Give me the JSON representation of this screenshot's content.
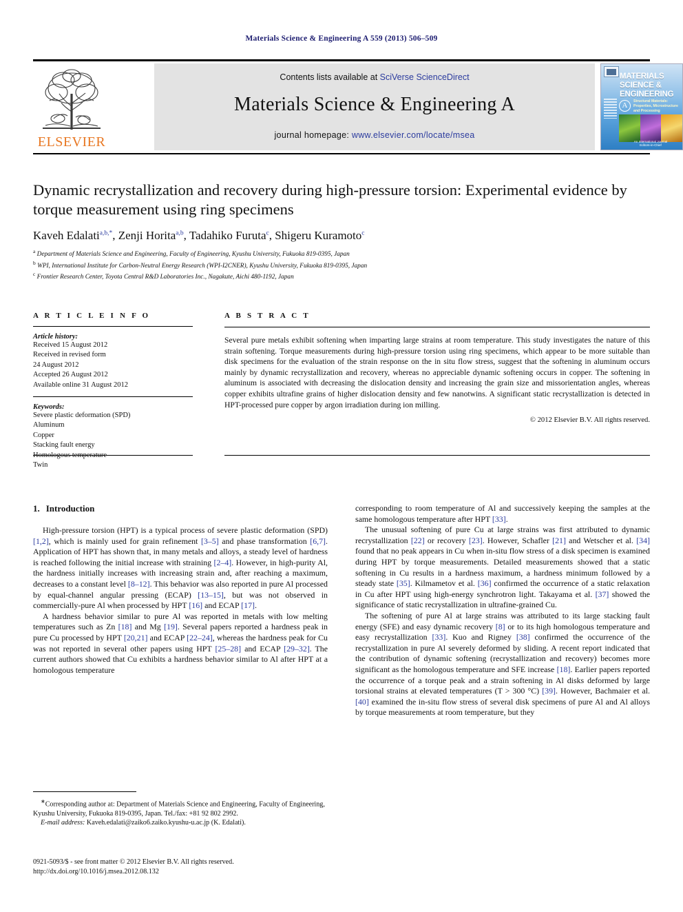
{
  "running_head": "Materials Science & Engineering A 559 (2013) 506–509",
  "masthead": {
    "publisher_name": "ELSEVIER",
    "contents_prefix": "Contents lists available at ",
    "contents_link": "SciVerse ScienceDirect",
    "journal_title": "Materials Science & Engineering A",
    "homepage_prefix": "journal homepage: ",
    "homepage_link": "www.elsevier.com/locate/msea",
    "cover": {
      "title": "MATERIALS SCIENCE & ENGINEERING",
      "series_badge": "A",
      "subtitle": "Structural Materials: Properties, Microstructure and Processing",
      "footer_line1": "An International Journal",
      "footer_line2": "Editors-in-Chief"
    }
  },
  "article": {
    "title": "Dynamic recrystallization and recovery during high-pressure torsion: Experimental evidence by torque measurement using ring specimens",
    "authors": [
      {
        "name": "Kaveh Edalati",
        "marks": "a,b,*"
      },
      {
        "name": "Zenji Horita",
        "marks": "a,b"
      },
      {
        "name": "Tadahiko Furuta",
        "marks": "c"
      },
      {
        "name": "Shigeru Kuramoto",
        "marks": "c"
      }
    ],
    "affiliations": [
      {
        "mark": "a",
        "text": "Department of Materials Science and Engineering, Faculty of Engineering, Kyushu University, Fukuoka 819-0395, Japan"
      },
      {
        "mark": "b",
        "text": "WPI, International Institute for Carbon-Neutral Energy Research (WPI-I2CNER), Kyushu University, Fukuoka 819-0395, Japan"
      },
      {
        "mark": "c",
        "text": "Frontier Research Center, Toyota Central R&D Laboratories Inc., Nagakute, Aichi 480-1192, Japan"
      }
    ]
  },
  "info": {
    "heading": "A R T I C L E   I N F O",
    "history_label": "Article history:",
    "history": [
      "Received 15 August 2012",
      "Received in revised form",
      "24 August 2012",
      "Accepted 26 August 2012",
      "Available online 31 August 2012"
    ],
    "keywords_label": "Keywords:",
    "keywords": [
      "Severe plastic deformation (SPD)",
      "Aluminum",
      "Copper",
      "Stacking fault energy",
      "Homologous temperature",
      "Twin"
    ]
  },
  "abstract": {
    "heading": "A B S T R A C T",
    "text": "Several pure metals exhibit softening when imparting large strains at room temperature. This study investigates the nature of this strain softening. Torque measurements during high-pressure torsion using ring specimens, which appear to be more suitable than disk specimens for the evaluation of the strain response on the in situ flow stress, suggest that the softening in aluminum occurs mainly by dynamic recrystallization and recovery, whereas no appreciable dynamic softening occurs in copper. The softening in aluminum is associated with decreasing the dislocation density and increasing the grain size and missorientation angles, whereas copper exhibits ultrafine grains of higher dislocation density and few nanotwins. A significant static recrystallization is detected in HPT-processed pure copper by argon irradiation during ion milling.",
    "copyright": "© 2012 Elsevier B.V. All rights reserved."
  },
  "body": {
    "section_number": "1.",
    "section_title": "Introduction",
    "left_paragraphs": [
      "High-pressure torsion (HPT) is a typical process of severe plastic deformation (SPD) [1,2], which is mainly used for grain refinement [3–5] and phase transformation [6,7]. Application of HPT has shown that, in many metals and alloys, a steady level of hardness is reached following the initial increase with straining [2–4]. However, in high-purity Al, the hardness initially increases with increasing strain and, after reaching a maximum, decreases to a constant level [8–12]. This behavior was also reported in pure Al processed by equal-channel angular pressing (ECAP) [13–15], but was not observed in commercially-pure Al when processed by HPT [16] and ECAP [17].",
      "A hardness behavior similar to pure Al was reported in metals with low melting temperatures such as Zn [18] and Mg [19]. Several papers reported a hardness peak in pure Cu processed by HPT [20,21] and ECAP [22–24], whereas the hardness peak for Cu was not reported in several other papers using HPT [25–28] and ECAP [29–32]. The current authors showed that Cu exhibits a hardness behavior similar to Al after HPT at a homologous temperature"
    ],
    "right_paragraphs": [
      "corresponding to room temperature of Al and successively keeping the samples at the same homologous temperature after HPT [33].",
      "The unusual softening of pure Cu at large strains was first attributed to dynamic recrystallization [22] or recovery [23]. However, Schafler [21] and Wetscher et al. [34] found that no peak appears in Cu when in-situ flow stress of a disk specimen is examined during HPT by torque measurements. Detailed measurements showed that a static softening in Cu results in a hardness maximum, a hardness minimum followed by a steady state [35]. Kilmametov et al. [36] confirmed the occurrence of a static relaxation in Cu after HPT using high-energy synchrotron light. Takayama et al. [37] showed the significance of static recrystallization in ultrafine-grained Cu.",
      "The softening of pure Al at large strains was attributed to its large stacking fault energy (SFE) and easy dynamic recovery [8] or to its high homologous temperature and easy recrystallization [33]. Kuo and Rigney [38] confirmed the occurrence of the recrystallization in pure Al severely deformed by sliding. A recent report indicated that the contribution of dynamic softening (recrystallization and recovery) becomes more significant as the homologous temperature and SFE increase [18]. Earlier papers reported the occurrence of a torque peak and a strain softening in Al disks deformed by large torsional strains at elevated temperatures (T > 300 °C) [39]. However, Bachmaier et al. [40] examined the in-situ flow stress of several disk specimens of pure Al and Al alloys by torque measurements at room temperature, but they"
    ]
  },
  "footnotes": {
    "corresponding": "Corresponding author at: Department of Materials Science and Engineering, Faculty of Engineering, Kyushu University, Fukuoka 819-0395, Japan. Tel./fax: +81 92 802 2992.",
    "email_label": "E-mail address:",
    "email_value": "Kaveh.edalati@zaiko6.zaiko.kyushu-u.ac.jp (K. Edalati)."
  },
  "imprint": {
    "line1": "0921-5093/$ - see front matter © 2012 Elsevier B.V. All rights reserved.",
    "line2": "http://dx.doi.org/10.1016/j.msea.2012.08.132"
  },
  "colors": {
    "link": "#2b3b9e",
    "running_head": "#1b1b6f",
    "elsevier_orange": "#e87722",
    "band": "#e3e3e3"
  }
}
